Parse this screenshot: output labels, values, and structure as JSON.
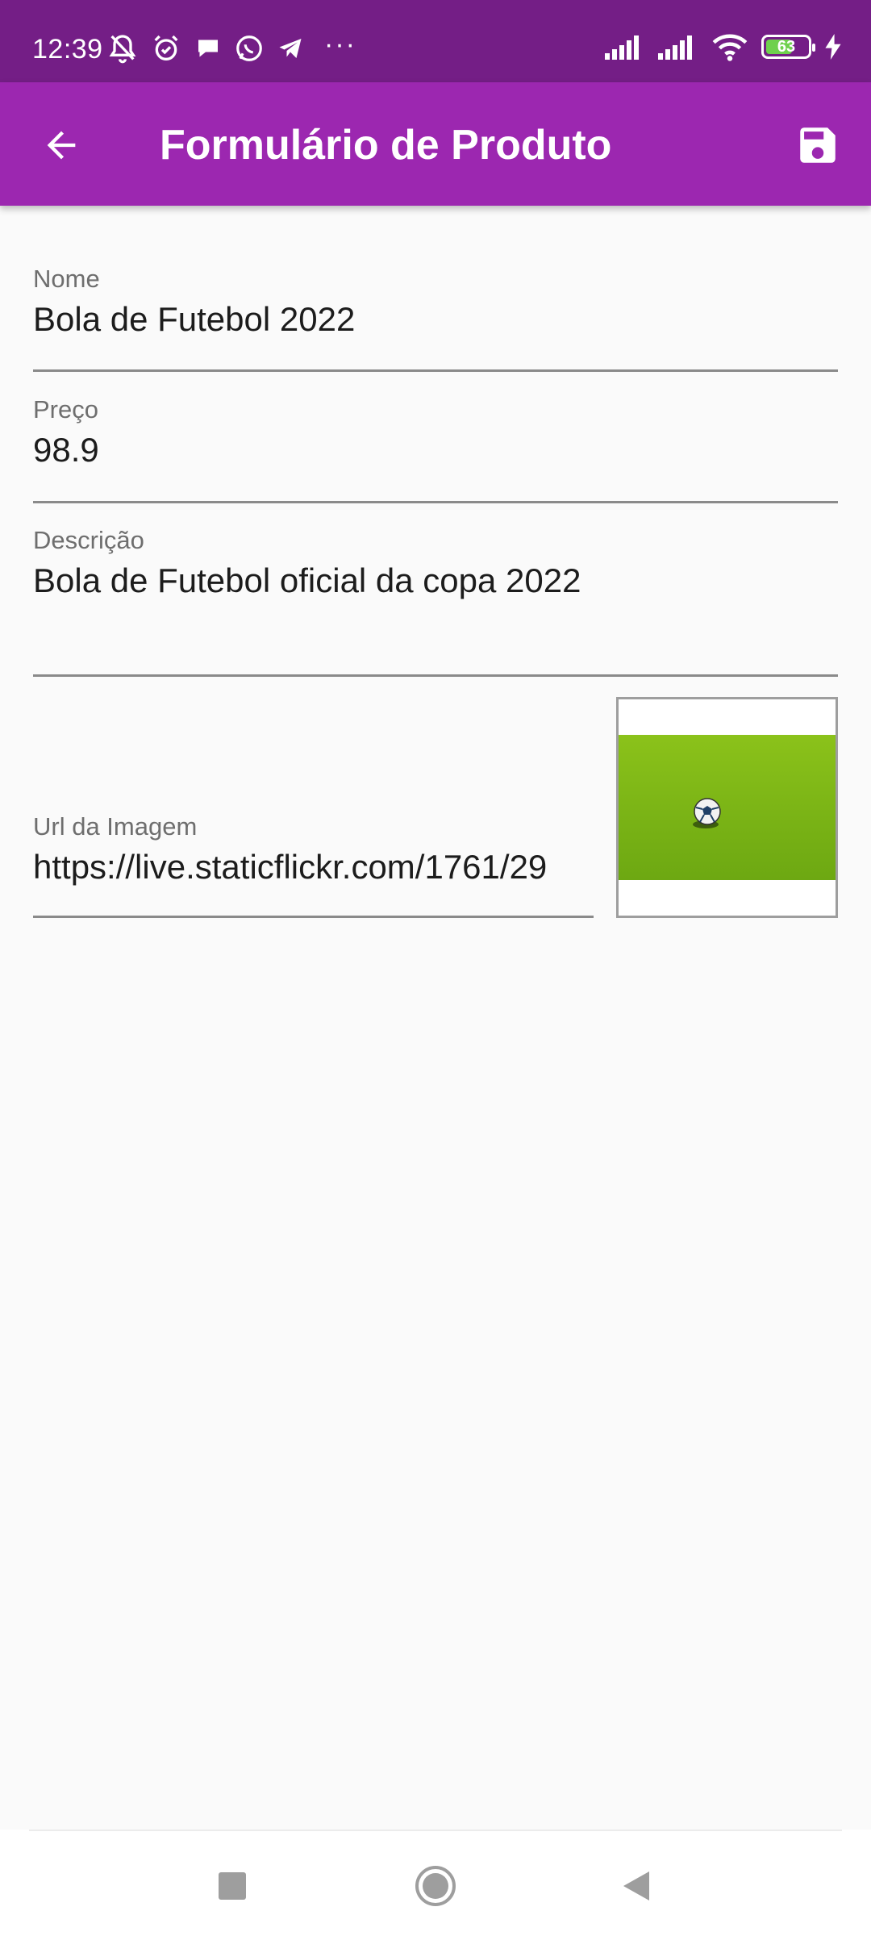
{
  "status_bar": {
    "time": "12:39",
    "battery_level": "63",
    "left_icons": [
      "muted-bell-icon",
      "alarm-icon",
      "chat-bubble-icon",
      "whatsapp-icon",
      "telegram-icon"
    ],
    "right_icons": [
      "signal-icon",
      "signal-icon",
      "wifi-icon",
      "battery-icon",
      "charging-bolt-icon"
    ]
  },
  "app_bar": {
    "title": "Formulário de Produto",
    "back_icon": "arrow-back-icon",
    "save_icon": "save-floppy-icon",
    "color": "#9c27b0"
  },
  "form": {
    "nome": {
      "label": "Nome",
      "value": "Bola de Futebol 2022"
    },
    "preco": {
      "label": "Preço",
      "value": "98.9"
    },
    "descricao": {
      "label": "Descrição",
      "value": "Bola de Futebol oficial da copa 2022"
    },
    "url": {
      "label": "Url da Imagem",
      "value": "https://live.staticflickr.com/1761/29"
    }
  },
  "image_preview": {
    "icon": "soccer-ball-on-grass-image"
  },
  "nav_bar": {
    "icons": [
      "recents-square-icon",
      "home-circle-icon",
      "back-triangle-icon"
    ]
  },
  "colors": {
    "status_bar": "#741e86",
    "app_bar": "#9c27b0",
    "background": "#fafafa",
    "grass": "#7cb518"
  }
}
